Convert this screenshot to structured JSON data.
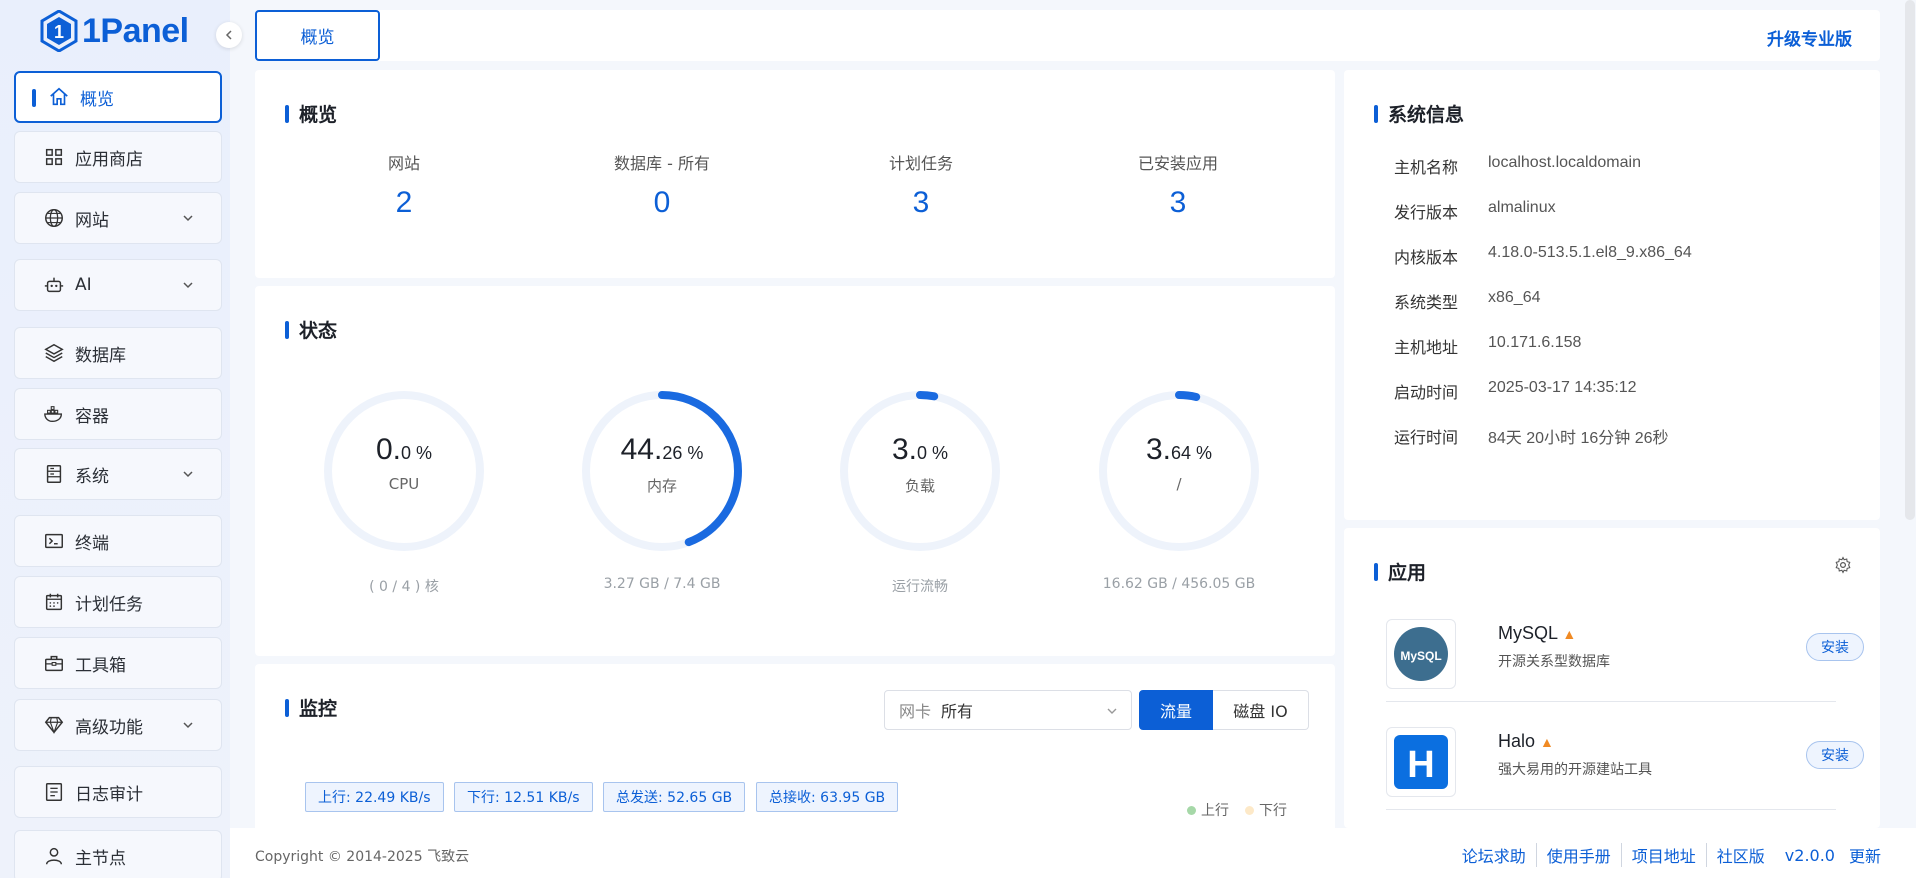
{
  "brand": {
    "name": "1Panel"
  },
  "sidebar": {
    "items": [
      {
        "label": "概览",
        "icon": "home-icon"
      },
      {
        "label": "应用商店",
        "icon": "grid-icon"
      },
      {
        "label": "网站",
        "icon": "globe-icon"
      },
      {
        "label": "AI",
        "icon": "robot-icon"
      },
      {
        "label": "数据库",
        "icon": "layers-icon"
      },
      {
        "label": "容器",
        "icon": "docker-icon"
      },
      {
        "label": "系统",
        "icon": "server-icon"
      },
      {
        "label": "终端",
        "icon": "terminal-icon"
      },
      {
        "label": "计划任务",
        "icon": "calendar-icon"
      },
      {
        "label": "工具箱",
        "icon": "toolbox-icon"
      },
      {
        "label": "高级功能",
        "icon": "diamond-icon"
      },
      {
        "label": "日志审计",
        "icon": "log-icon"
      },
      {
        "label": "主节点",
        "icon": "user-icon"
      }
    ]
  },
  "topbar": {
    "tab": "概览",
    "upgrade": "升级专业版"
  },
  "overview": {
    "title": "概览",
    "stats": [
      {
        "label": "网站",
        "value": "2"
      },
      {
        "label": "数据库 - 所有",
        "value": "0"
      },
      {
        "label": "计划任务",
        "value": "3"
      },
      {
        "label": "已安装应用",
        "value": "3"
      }
    ]
  },
  "status": {
    "title": "状态",
    "gauges": [
      {
        "int": "0.",
        "dec": "0 %",
        "label": "CPU",
        "foot": "( 0 / 4 ) 核",
        "percent": 0
      },
      {
        "int": "44.",
        "dec": "26 %",
        "label": "内存",
        "foot": "3.27 GB / 7.4 GB",
        "percent": 44.26
      },
      {
        "int": "3.",
        "dec": "0 %",
        "label": "负载",
        "foot": "运行流畅",
        "percent": 3
      },
      {
        "int": "3.",
        "dec": "64 %",
        "label": "/",
        "foot": "16.62 GB / 456.05 GB",
        "percent": 3.64
      }
    ]
  },
  "sysinfo": {
    "title": "系统信息",
    "rows": [
      {
        "k": "主机名称",
        "v": "localhost.localdomain"
      },
      {
        "k": "发行版本",
        "v": "almalinux"
      },
      {
        "k": "内核版本",
        "v": "4.18.0-513.5.1.el8_9.x86_64"
      },
      {
        "k": "系统类型",
        "v": "x86_64"
      },
      {
        "k": "主机地址",
        "v": "10.171.6.158"
      },
      {
        "k": "启动时间",
        "v": "2025-03-17 14:35:12"
      },
      {
        "k": "运行时间",
        "v": "84天 20小时 16分钟 26秒"
      }
    ]
  },
  "monitor": {
    "title": "监控",
    "nic_placeholder": "网卡",
    "nic_value": "所有",
    "seg_on": "流量",
    "seg_off": "磁盘 IO",
    "tags": [
      "上行: 22.49 KB/s",
      "下行: 12.51 KB/s",
      "总发送: 52.65 GB",
      "总接收: 63.95 GB"
    ],
    "legend": [
      {
        "label": "上行",
        "color": "#a6d8a8"
      },
      {
        "label": "下行",
        "color": "#fde9c8"
      }
    ]
  },
  "apps": {
    "title": "应用",
    "items": [
      {
        "name": "MySQL",
        "desc": "开源关系型数据库",
        "button": "安装",
        "logo_text": "MySQL"
      },
      {
        "name": "Halo",
        "desc": "强大易用的开源建站工具",
        "button": "安装",
        "logo_text": "H"
      }
    ]
  },
  "footer": {
    "copyright": "Copyright © 2014-2025 飞致云",
    "links": [
      "论坛求助",
      "使用手册",
      "项目地址",
      "社区版"
    ],
    "version": "v2.0.0",
    "update": "更新"
  },
  "colors": {
    "accent": "#0c5fd6",
    "gauge_track": "#eef3fb",
    "gauge_fill": "#1a6ae0"
  }
}
